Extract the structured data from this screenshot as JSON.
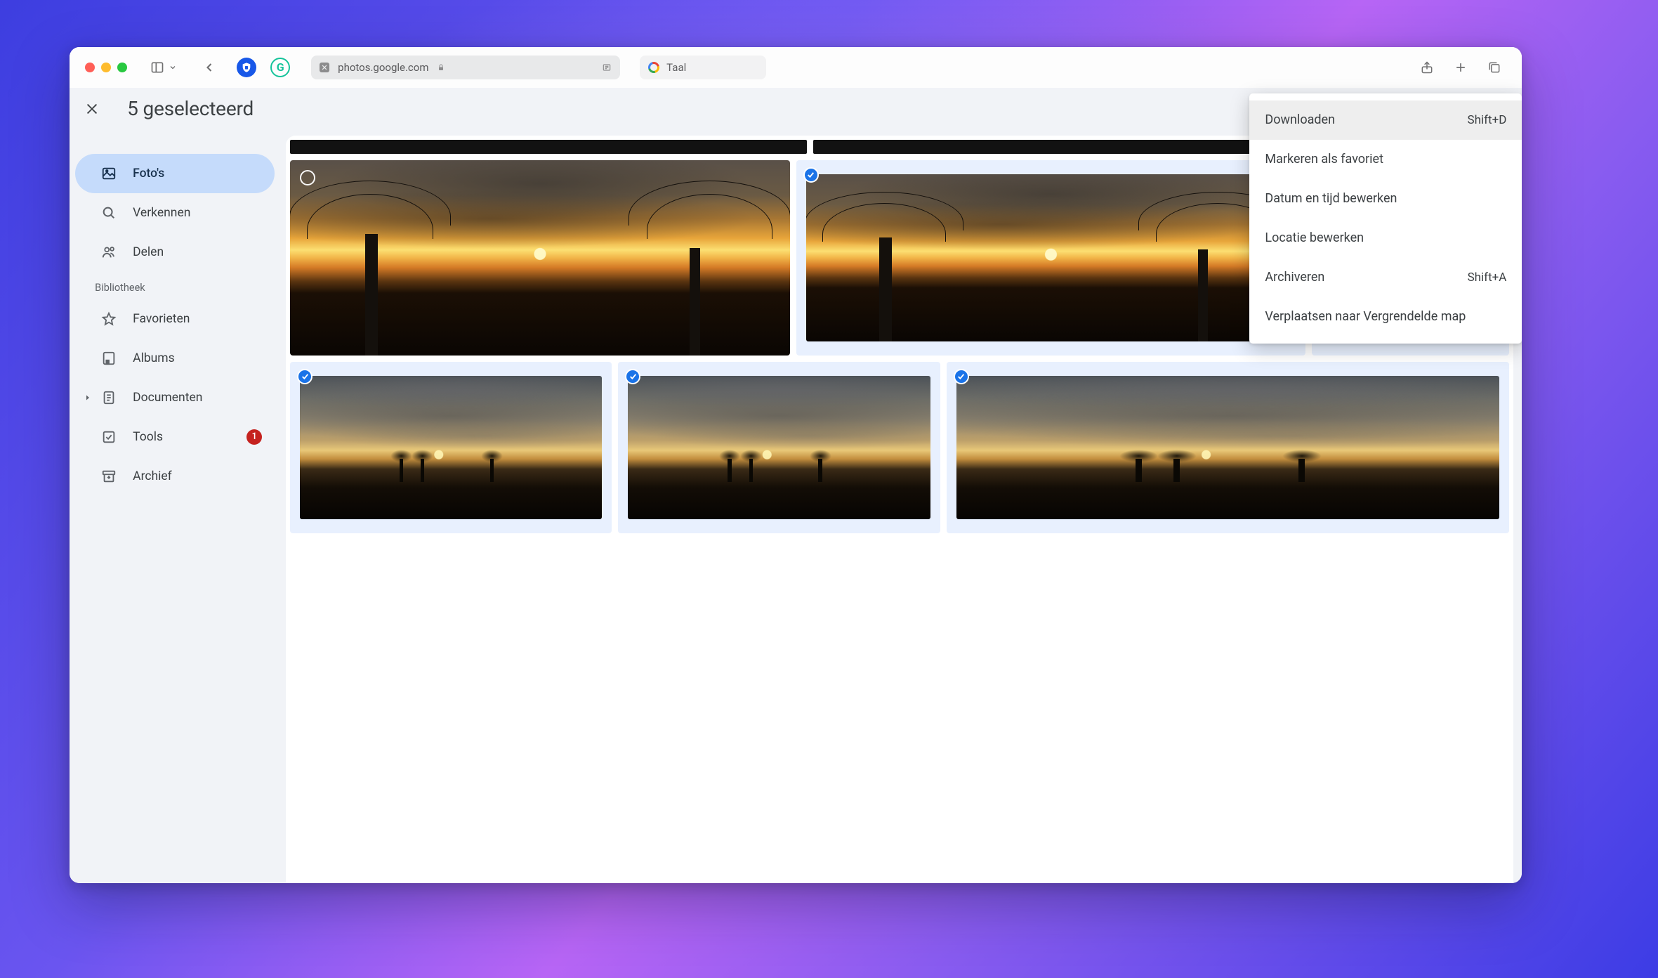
{
  "browser": {
    "url": "photos.google.com",
    "search_value": "Taal"
  },
  "selection": {
    "title": "5 geselecteerd"
  },
  "sidebar": {
    "photos": "Foto's",
    "explore": "Verkennen",
    "share": "Delen",
    "library_heading": "Bibliotheek",
    "favorites": "Favorieten",
    "albums": "Albums",
    "documents": "Documenten",
    "tools": "Tools",
    "tools_badge": "1",
    "archive": "Archief"
  },
  "context_menu": [
    {
      "label": "Downloaden",
      "shortcut": "Shift+D",
      "hover": true
    },
    {
      "label": "Markeren als favoriet",
      "shortcut": ""
    },
    {
      "label": "Datum en tijd bewerken",
      "shortcut": ""
    },
    {
      "label": "Locatie bewerken",
      "shortcut": ""
    },
    {
      "label": "Archiveren",
      "shortcut": "Shift+A"
    },
    {
      "label": "Verplaatsen naar Vergrendelde map",
      "shortcut": ""
    }
  ]
}
